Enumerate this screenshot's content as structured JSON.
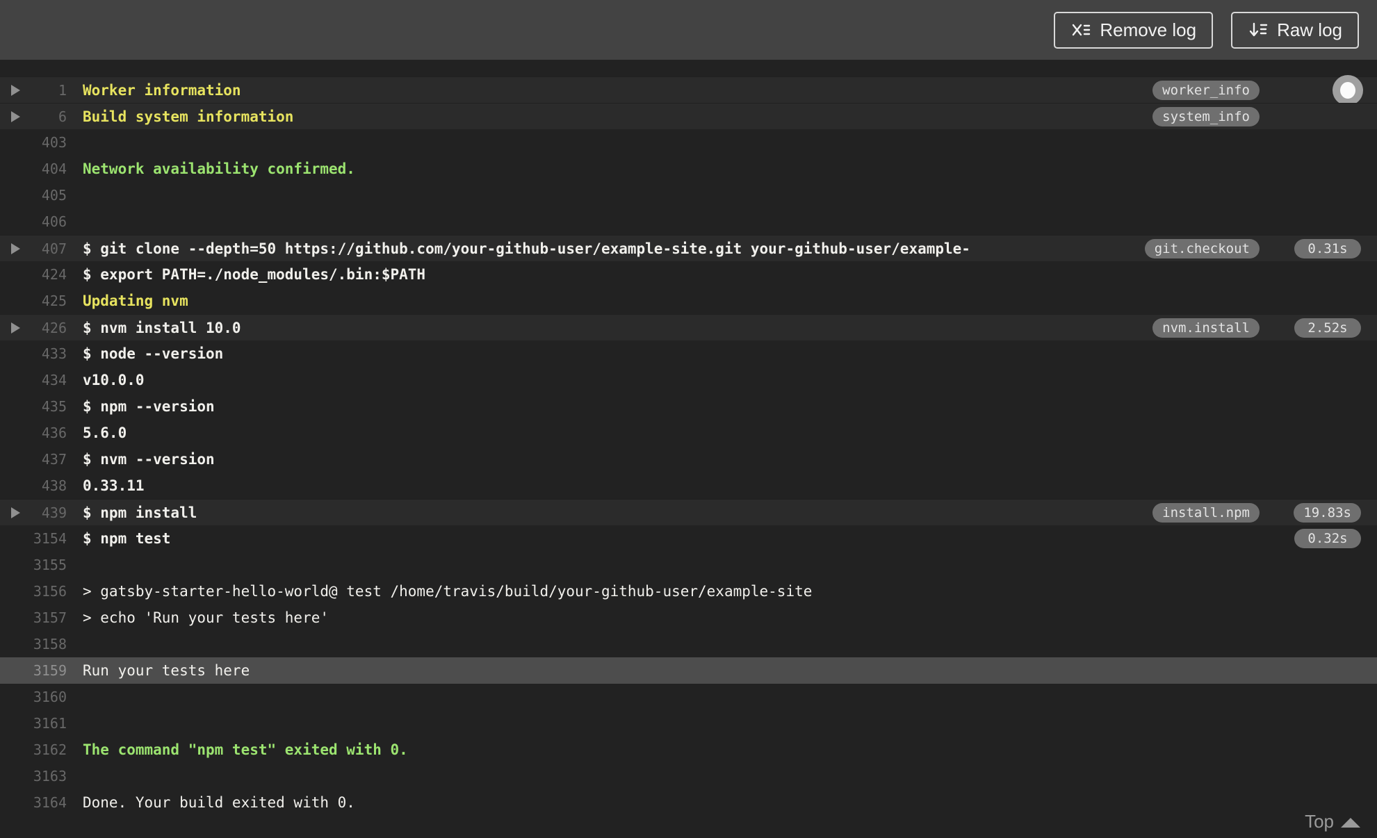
{
  "toolbar": {
    "remove_log_label": "Remove log",
    "raw_log_label": "Raw log"
  },
  "log": {
    "lines": [
      {
        "number": "1",
        "text": "Worker information",
        "style": "header",
        "fold": true,
        "section": true,
        "tag": "worker_info",
        "scroll_knob": true
      },
      {
        "number": "6",
        "text": "Build system information",
        "style": "header",
        "fold": true,
        "section": true,
        "tag": "system_info"
      },
      {
        "number": "403",
        "text": "",
        "style": "plain"
      },
      {
        "number": "404",
        "text": "Network availability confirmed.",
        "style": "success"
      },
      {
        "number": "405",
        "text": "",
        "style": "plain"
      },
      {
        "number": "406",
        "text": "",
        "style": "plain"
      },
      {
        "number": "407",
        "text": "$ git clone --depth=50 https://github.com/your-github-user/example-site.git your-github-user/example-",
        "style": "strong",
        "fold": true,
        "section": true,
        "tag": "git.checkout",
        "duration": "0.31s"
      },
      {
        "number": "424",
        "text": "$ export PATH=./node_modules/.bin:$PATH",
        "style": "strong"
      },
      {
        "number": "425",
        "text": "Updating nvm",
        "style": "header"
      },
      {
        "number": "426",
        "text": "$ nvm install 10.0",
        "style": "strong",
        "fold": true,
        "section": true,
        "tag": "nvm.install",
        "duration": "2.52s"
      },
      {
        "number": "433",
        "text": "$ node --version",
        "style": "strong"
      },
      {
        "number": "434",
        "text": "v10.0.0",
        "style": "strong"
      },
      {
        "number": "435",
        "text": "$ npm --version",
        "style": "strong"
      },
      {
        "number": "436",
        "text": "5.6.0",
        "style": "strong"
      },
      {
        "number": "437",
        "text": "$ nvm --version",
        "style": "strong"
      },
      {
        "number": "438",
        "text": "0.33.11",
        "style": "strong"
      },
      {
        "number": "439",
        "text": "$ npm install",
        "style": "strong",
        "fold": true,
        "section": true,
        "tag": "install.npm",
        "duration": "19.83s"
      },
      {
        "number": "3154",
        "text": "$ npm test",
        "style": "strong",
        "duration": "0.32s"
      },
      {
        "number": "3155",
        "text": "",
        "style": "plain"
      },
      {
        "number": "3156",
        "text": "> gatsby-starter-hello-world@ test /home/travis/build/your-github-user/example-site",
        "style": "plain"
      },
      {
        "number": "3157",
        "text": "> echo 'Run your tests here'",
        "style": "plain"
      },
      {
        "number": "3158",
        "text": "",
        "style": "plain"
      },
      {
        "number": "3159",
        "text": "Run your tests here",
        "style": "plain",
        "highlighted": true
      },
      {
        "number": "3160",
        "text": "",
        "style": "plain"
      },
      {
        "number": "3161",
        "text": "",
        "style": "plain"
      },
      {
        "number": "3162",
        "text": "The command \"npm test\" exited with 0.",
        "style": "success"
      },
      {
        "number": "3163",
        "text": "",
        "style": "plain"
      },
      {
        "number": "3164",
        "text": "Done. Your build exited with 0.",
        "style": "plain"
      }
    ]
  },
  "footer": {
    "top_label": "Top"
  },
  "colors": {
    "topbar_bg": "#434343",
    "log_bg": "#222222",
    "fold_row_bg": "#2b2b2b",
    "highlight_row_bg": "#4d4d4d",
    "header_text": "#e7e35f",
    "success_text": "#9ce470",
    "plain_text": "#f1f0ec",
    "line_number": "#686868",
    "pill_bg": "#6f6f6f",
    "pill_text": "#e3e3e3"
  }
}
